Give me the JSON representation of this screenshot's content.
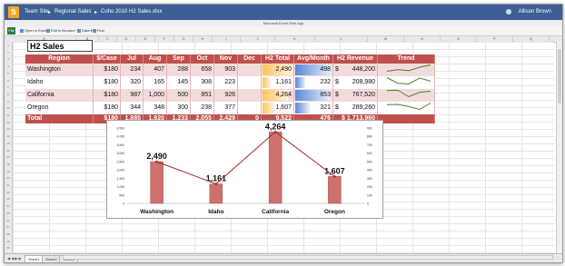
{
  "titlebar": {
    "logo": "S",
    "breadcrumb": [
      "Team Site",
      "Regional Sales",
      "Coho 2010 H2 Sales.xlsx"
    ],
    "user": "Allison Brown"
  },
  "app_name": "Microsoft Excel Web App",
  "ribbon": {
    "file_label": "File",
    "commands": [
      "Open in Excel",
      "Edit in Browser",
      "Data",
      "Find"
    ]
  },
  "columns": [
    "A",
    "B",
    "C",
    "D",
    "E",
    "F",
    "G",
    "H",
    "I",
    "J",
    "K",
    "L",
    "M",
    "N",
    "O",
    "P",
    "Q",
    "R",
    "S"
  ],
  "rows": [
    "1",
    "2",
    "3",
    "4",
    "5",
    "6",
    "7",
    "8",
    "9",
    "10",
    "11",
    "12",
    "13",
    "14",
    "15",
    "16",
    "17",
    "18",
    "19",
    "20",
    "21",
    "22",
    "23",
    "24",
    "25",
    "26",
    "27",
    "28",
    "29",
    "30"
  ],
  "sheet_title": "H2 Sales",
  "table": {
    "headers": [
      "Region",
      "$/Case",
      "Jul",
      "Aug",
      "Sep",
      "Oct",
      "Nov",
      "Dec",
      "H2  Total",
      "Avg/Month",
      "H2 Revenue",
      "Trend"
    ],
    "rows": [
      {
        "region": "Washington",
        "case": "$180",
        "jul": "234",
        "aug": "407",
        "sep": "288",
        "oct": "658",
        "nov": "903",
        "dec": "",
        "total": "2,490",
        "avg": "498",
        "rev_cur": "$",
        "rev": "448,200",
        "total_frac": 1.0,
        "avg_frac": 1.0
      },
      {
        "region": "Idaho",
        "case": "$180",
        "jul": "320",
        "aug": "165",
        "sep": "145",
        "oct": "308",
        "nov": "223",
        "dec": "",
        "total": "1,161",
        "avg": "232",
        "rev_cur": "$",
        "rev": "208,980",
        "total_frac": 0.27,
        "avg_frac": 0.27
      },
      {
        "region": "California",
        "case": "$180",
        "jul": "987",
        "aug": "1,000",
        "sep": "500",
        "oct": "851",
        "nov": "926",
        "dec": "",
        "total": "4,264",
        "avg": "853",
        "rev_cur": "$",
        "rev": "767,520",
        "total_frac": 0.85,
        "avg_frac": 0.95
      },
      {
        "region": "Oregon",
        "case": "$180",
        "jul": "344",
        "aug": "348",
        "sep": "300",
        "oct": "238",
        "nov": "377",
        "dec": "",
        "total": "1,607",
        "avg": "321",
        "rev_cur": "$",
        "rev": "289,260",
        "total_frac": 0.4,
        "avg_frac": 0.4
      }
    ],
    "total": {
      "region": "Total",
      "case": "$180",
      "jul": "1,885",
      "aug": "1,920",
      "sep": "1,233",
      "oct": "2,055",
      "nov": "2,429",
      "dec": "0",
      "total": "9,522",
      "avg": "476",
      "rev": "$ 1,713,960"
    }
  },
  "sparklines": [
    [
      234,
      407,
      288,
      658,
      903
    ],
    [
      320,
      165,
      145,
      308,
      223
    ],
    [
      987,
      1000,
      500,
      851,
      926
    ],
    [
      344,
      348,
      300,
      238,
      377
    ]
  ],
  "colors": {
    "accent": "#c0504d",
    "row_alt": "#f2dcdb",
    "bar_fill": "#c76260",
    "line": "#a52a2a",
    "titlebar": "#3d5f96"
  },
  "chart_data": {
    "type": "bar",
    "categories": [
      "Washington",
      "Idaho",
      "California",
      "Oregon"
    ],
    "series": [
      {
        "values": [
          2490,
          1161,
          4264,
          1607
        ]
      },
      {
        "values": [
          498,
          232,
          853,
          321
        ]
      }
    ],
    "data_labels": [
      "2,490",
      "1,161",
      "4,264",
      "1,607"
    ],
    "y_left": {
      "ticks": [
        "4,500",
        "4,000",
        "3,500",
        "3,000",
        "2,500",
        "2,000",
        "1,500",
        "1,000",
        "500",
        "0"
      ],
      "ylim": [
        0,
        4500
      ]
    },
    "y_right": {
      "ticks": [
        "900",
        "800",
        "700",
        "600",
        "500",
        "400",
        "300",
        "200",
        "100",
        "0"
      ],
      "ylim": [
        0,
        900
      ]
    },
    "line_on_secondary_axis": true,
    "grid": false,
    "legend": "none"
  },
  "sheet_tabs": [
    "Sheet1",
    "Sheet2",
    "Sheet3"
  ],
  "sheet_nav": "◀ ◀ ▶ ▶"
}
